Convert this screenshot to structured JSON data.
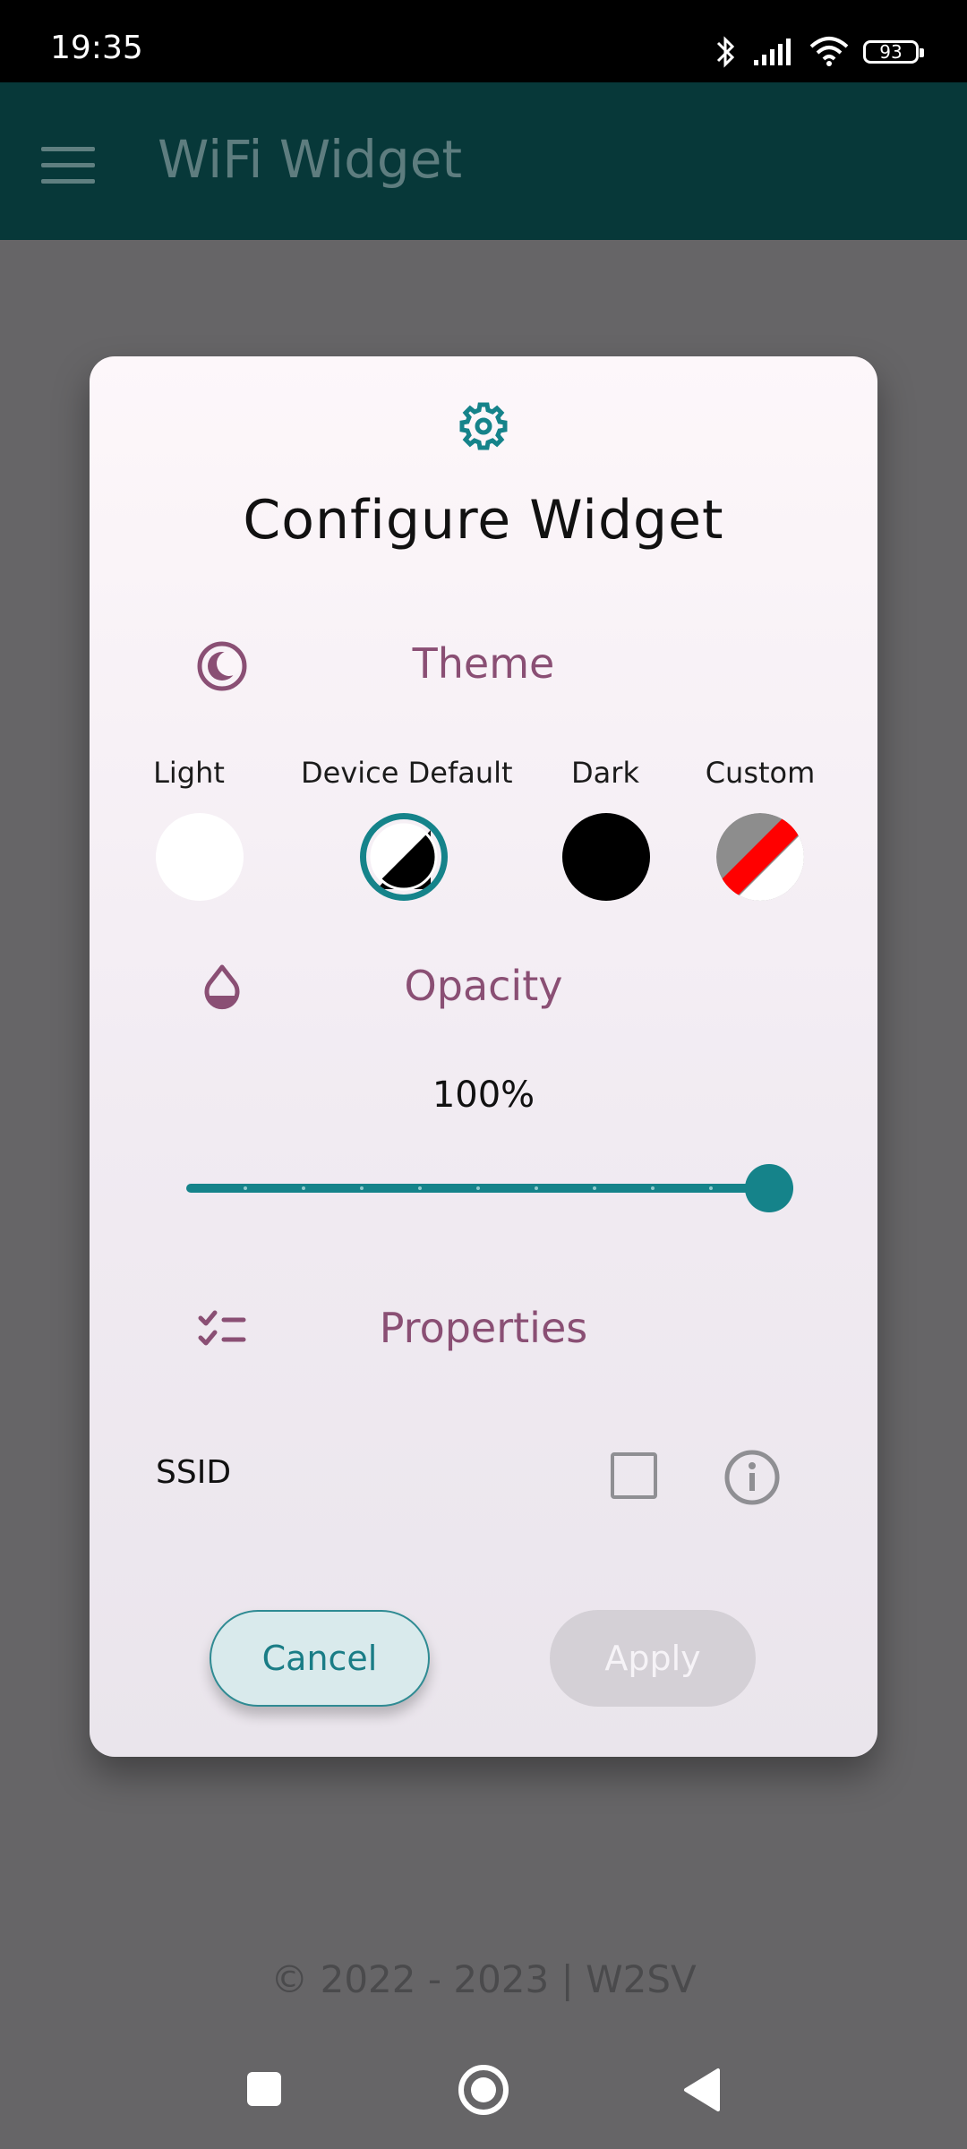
{
  "status_bar": {
    "time": "19:35",
    "battery_level": "93"
  },
  "app_bar": {
    "title": "WiFi Widget"
  },
  "dialog": {
    "title": "Configure Widget",
    "theme": {
      "label": "Theme",
      "options": [
        {
          "label": "Light"
        },
        {
          "label": "Device Default"
        },
        {
          "label": "Dark"
        },
        {
          "label": "Custom"
        }
      ],
      "selected": "Device Default"
    },
    "opacity": {
      "label": "Opacity",
      "value_text": "100%",
      "value": 100
    },
    "properties": {
      "label": "Properties",
      "items": [
        {
          "label": "SSID",
          "checked": false
        }
      ]
    },
    "buttons": {
      "cancel": "Cancel",
      "apply": "Apply"
    }
  },
  "footer": {
    "copyright": "© 2022 - 2023 | W2SV"
  },
  "colors": {
    "accent": "#15838A",
    "section": "#8A4F74",
    "custom_red": "#FF0000"
  }
}
